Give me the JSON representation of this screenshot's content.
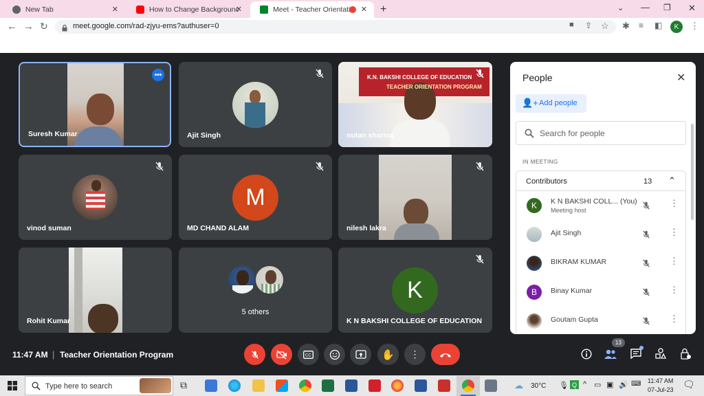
{
  "browser": {
    "tabs": [
      {
        "title": "New Tab",
        "favicon": "globe-icon"
      },
      {
        "title": "How to Change Background in G",
        "favicon": "youtube-icon"
      },
      {
        "title": "Meet - Teacher Orientation P",
        "favicon": "meet-icon"
      }
    ],
    "url": "meet.google.com/rad-zjyu-ems?authuser=0",
    "profile_letter": "K"
  },
  "tiles": [
    {
      "name": "Suresh Kumar",
      "type": "video",
      "menu_icon": "more-options-icon"
    },
    {
      "name": "Ajit Singh",
      "type": "photo-avatar",
      "muted": true
    },
    {
      "name": "nutan sharma",
      "type": "video",
      "muted": true,
      "banner_line1": "K.N. BAKSHI COLLEGE OF EDUCATION",
      "banner_line2": "TEACHER ORIENTATION PROGRAM"
    },
    {
      "name": "vinod suman",
      "type": "photo-avatar",
      "muted": true
    },
    {
      "name": "MD CHAND ALAM",
      "type": "letter-avatar",
      "letter": "M",
      "muted": true
    },
    {
      "name": "nilesh lakra",
      "type": "video",
      "muted": true
    },
    {
      "name": "Rohit Kumar",
      "type": "video"
    },
    {
      "name": "5 others",
      "type": "others"
    },
    {
      "name": "K N BAKSHI COLLEGE OF EDUCATION",
      "type": "letter-avatar",
      "letter": "K",
      "muted": true
    }
  ],
  "people_panel": {
    "title": "People",
    "add_people": "Add people",
    "search_placeholder": "Search for people",
    "section_label": "IN MEETING",
    "group_label": "Contributors",
    "group_count": "13",
    "people": [
      {
        "name": "K N BAKSHI COLL...",
        "suffix": "(You)",
        "sub": "Meeting host",
        "avatar_letter": "K"
      },
      {
        "name": "Ajit Singh"
      },
      {
        "name": "BIKRAM KUMAR"
      },
      {
        "name": "Binay Kumar",
        "avatar_letter": "B"
      },
      {
        "name": "Goutam Gupta"
      }
    ]
  },
  "meeting_bar": {
    "time": "11:47 AM",
    "separator": "|",
    "title": "Teacher Orientation Program",
    "people_badge": "13"
  },
  "taskbar": {
    "search_placeholder": "Type here to search",
    "weather": "30°C",
    "clock_time": "11:47 AM",
    "clock_date": "07-Jul-23"
  },
  "colors": {
    "meet_bg": "#202124",
    "tile_bg": "#3c4043",
    "accent_blue": "#1a73e8",
    "end_call_red": "#ea4335",
    "avatar_m": "#d2481a",
    "avatar_k": "#33691e",
    "avatar_b": "#7b1fa2"
  }
}
